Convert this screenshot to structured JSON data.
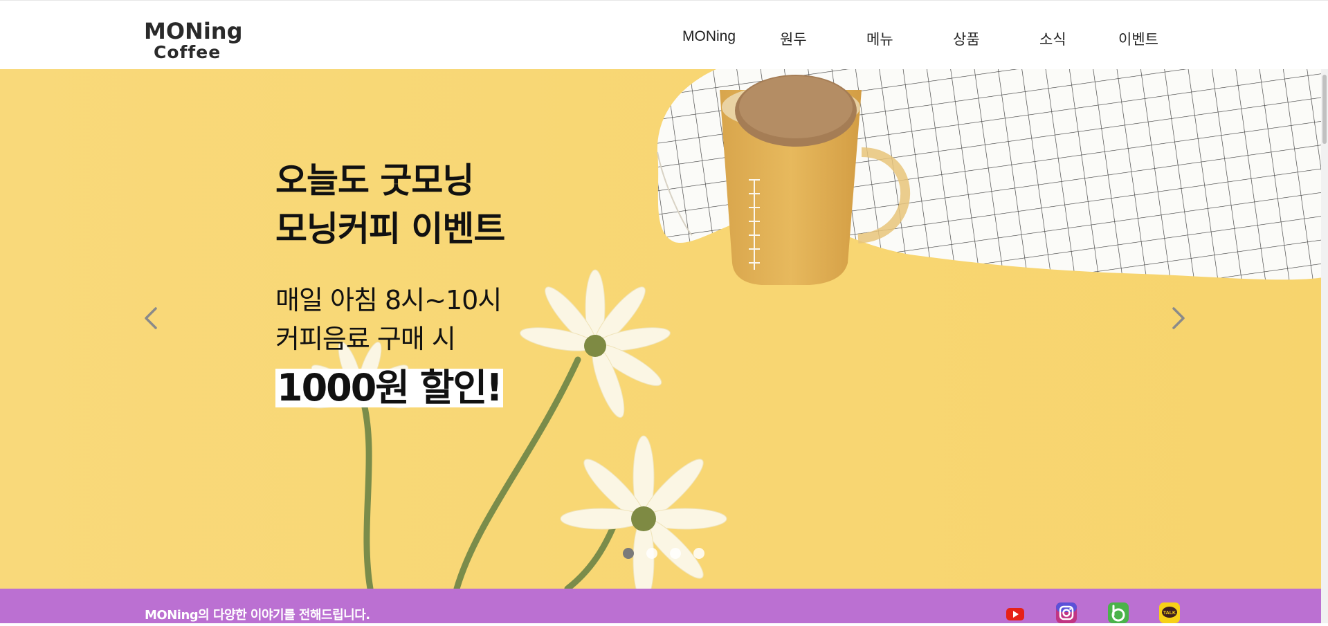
{
  "brand": {
    "logo_line1": "MONing",
    "logo_line2": "Coffee"
  },
  "nav": {
    "items": [
      "MONing",
      "원두",
      "메뉴",
      "상품",
      "소식",
      "이벤트"
    ]
  },
  "hero": {
    "headline_line1": "오늘도 굿모닝",
    "headline_line2": "모닝커피 이벤트",
    "sub_line1": "매일 아침 8시~10시",
    "sub_line2": "커피음료 구매 시",
    "highlight": "1000원 할인!",
    "prev_icon": "chevron-left-icon",
    "next_icon": "chevron-right-icon",
    "slides_total": 4,
    "active_slide": 1,
    "background_color": "#f8d876"
  },
  "infobar": {
    "text": "MONing의 다양한 이야기를 전해드립니다.",
    "background_color": "#bb70d2",
    "sns": [
      "youtube-icon",
      "instagram-icon",
      "band-icon",
      "kakaotalk-icon"
    ],
    "kakao_label": "TALK"
  }
}
